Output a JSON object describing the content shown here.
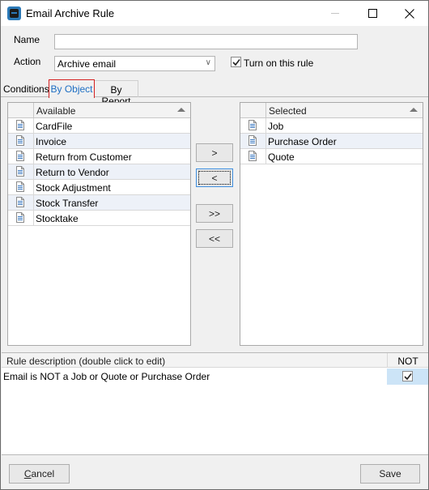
{
  "window": {
    "title": "Email Archive Rule",
    "icon": "app-logo-icon",
    "controls": [
      "minimize-icon",
      "maximize-icon",
      "close-icon"
    ]
  },
  "form": {
    "name_label": "Name",
    "name_value": "",
    "action_label": "Action",
    "action_value": "Archive email",
    "turn_on_label": "Turn on this rule",
    "turn_on_checked": true
  },
  "tabs": [
    {
      "label": "Conditions",
      "active": false
    },
    {
      "label": "By Object",
      "active": true
    },
    {
      "label": "By Report",
      "active": false
    }
  ],
  "available": {
    "header": "Available",
    "sort": "ascending",
    "items": [
      "CardFile",
      "Invoice",
      "Return from Customer",
      "Return to Vendor",
      "Stock Adjustment",
      "Stock Transfer",
      "Stocktake"
    ]
  },
  "selected": {
    "header": "Selected",
    "sort": "ascending",
    "items": [
      "Job",
      "Purchase Order",
      "Quote"
    ]
  },
  "transfer_buttons": {
    "add": ">",
    "remove": "<",
    "add_all": ">>",
    "remove_all": "<<"
  },
  "rule": {
    "header": "Rule description (double click to edit)",
    "not_header": "NOT",
    "description": "Email is NOT a Job or Quote or Purchase Order",
    "not_checked": true
  },
  "footer": {
    "cancel_prefix": "",
    "cancel_mnemonic": "C",
    "cancel_rest": "ancel",
    "save_label": "Save"
  }
}
